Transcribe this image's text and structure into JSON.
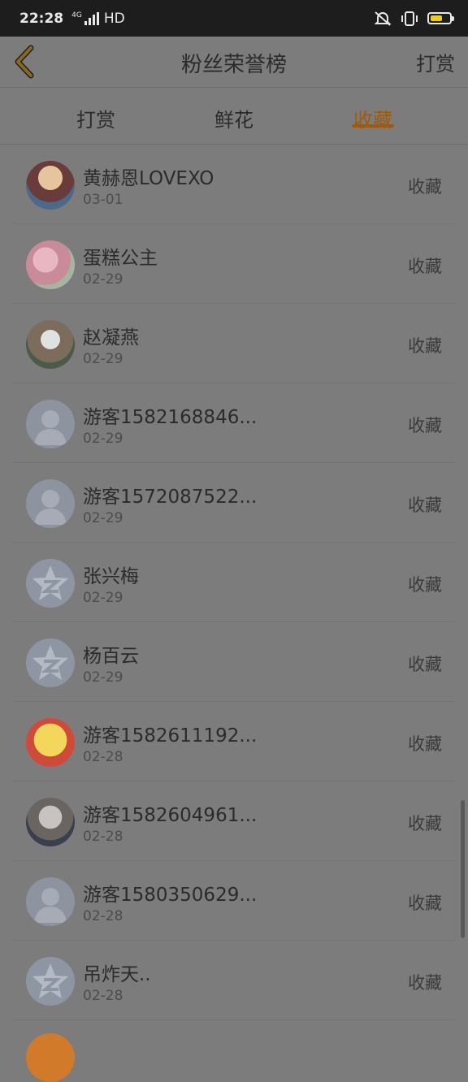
{
  "status": {
    "time": "22:28",
    "network": "4G",
    "hd": "HD",
    "colors": {
      "bar": "#1d1d1d",
      "battery": "#f5d000"
    }
  },
  "header": {
    "back_icon": "chevron-left-icon",
    "title": "粉丝荣誉榜",
    "right_link": "打赏"
  },
  "tabs": [
    {
      "label": "打赏",
      "active": false
    },
    {
      "label": "鲜花",
      "active": false
    },
    {
      "label": "收藏",
      "active": true
    }
  ],
  "accent": "#a05a08",
  "fans": [
    {
      "name": "黄赫恩LOVEXO",
      "date": "03-01",
      "action": "收藏",
      "avatar": "photo"
    },
    {
      "name": "蛋糕公主",
      "date": "02-29",
      "action": "收藏",
      "avatar": "photo"
    },
    {
      "name": "赵凝燕",
      "date": "02-29",
      "action": "收藏",
      "avatar": "photo"
    },
    {
      "name": "游客1582168846...",
      "date": "02-29",
      "action": "收藏",
      "avatar": "default-user-icon"
    },
    {
      "name": "游客1572087522...",
      "date": "02-29",
      "action": "收藏",
      "avatar": "default-user-icon"
    },
    {
      "name": "张兴梅",
      "date": "02-29",
      "action": "收藏",
      "avatar": "qzone-star-icon"
    },
    {
      "name": "杨百云",
      "date": "02-29",
      "action": "收藏",
      "avatar": "qzone-star-icon"
    },
    {
      "name": "游客1582611192...",
      "date": "02-28",
      "action": "收藏",
      "avatar": "photo"
    },
    {
      "name": "游客1582604961...",
      "date": "02-28",
      "action": "收藏",
      "avatar": "photo"
    },
    {
      "name": "游客1580350629...",
      "date": "02-28",
      "action": "收藏",
      "avatar": "default-user-icon"
    },
    {
      "name": "吊炸天..",
      "date": "02-28",
      "action": "收藏",
      "avatar": "qzone-star-icon"
    }
  ]
}
